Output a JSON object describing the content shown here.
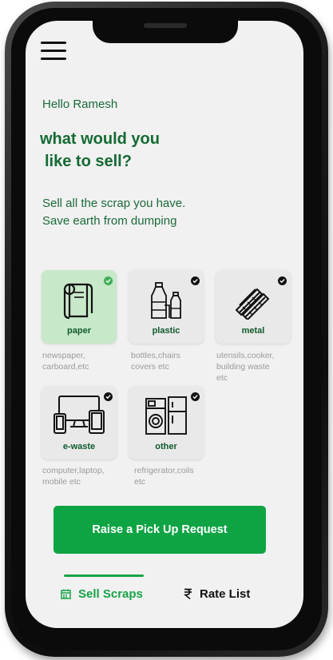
{
  "header": {
    "menu_icon": "hamburger-menu-icon"
  },
  "greeting": "Hello Ramesh",
  "headline": {
    "line1": "what would you",
    "line2": "like to sell?"
  },
  "subtitle": {
    "line1": "Sell all the scrap you have.",
    "line2": "Save earth from dumping"
  },
  "categories": [
    {
      "label": "paper",
      "desc_line1": "newspaper,",
      "desc_line2": "carboard,etc",
      "desc_line3": "",
      "icon": "paper-roll-icon",
      "selected": true
    },
    {
      "label": "plastic",
      "desc_line1": "bottles,chairs",
      "desc_line2": "covers etc",
      "desc_line3": "",
      "icon": "plastic-bottles-icon",
      "selected": false
    },
    {
      "label": "metal",
      "desc_line1": "utensils,cooker,",
      "desc_line2": "building waste",
      "desc_line3": "etc",
      "icon": "metal-rods-icon",
      "selected": false
    },
    {
      "label": "e-waste",
      "desc_line1": "computer,laptop,",
      "desc_line2": "mobile etc",
      "desc_line3": "",
      "icon": "electronics-devices-icon",
      "selected": false
    },
    {
      "label": "other",
      "desc_line1": "refrigerator,coils",
      "desc_line2": "etc",
      "desc_line3": "",
      "icon": "appliances-icon",
      "selected": false
    }
  ],
  "cta_label": "Raise a Pick Up Request",
  "tabs": [
    {
      "label": "Sell Scraps",
      "icon": "calendar-icon",
      "active": true
    },
    {
      "label": "Rate List",
      "icon": "rupee-icon",
      "active": false
    }
  ],
  "colors": {
    "brand_green": "#0ea444",
    "text_green": "#146a33",
    "selected_card": "#c7e8c9"
  }
}
